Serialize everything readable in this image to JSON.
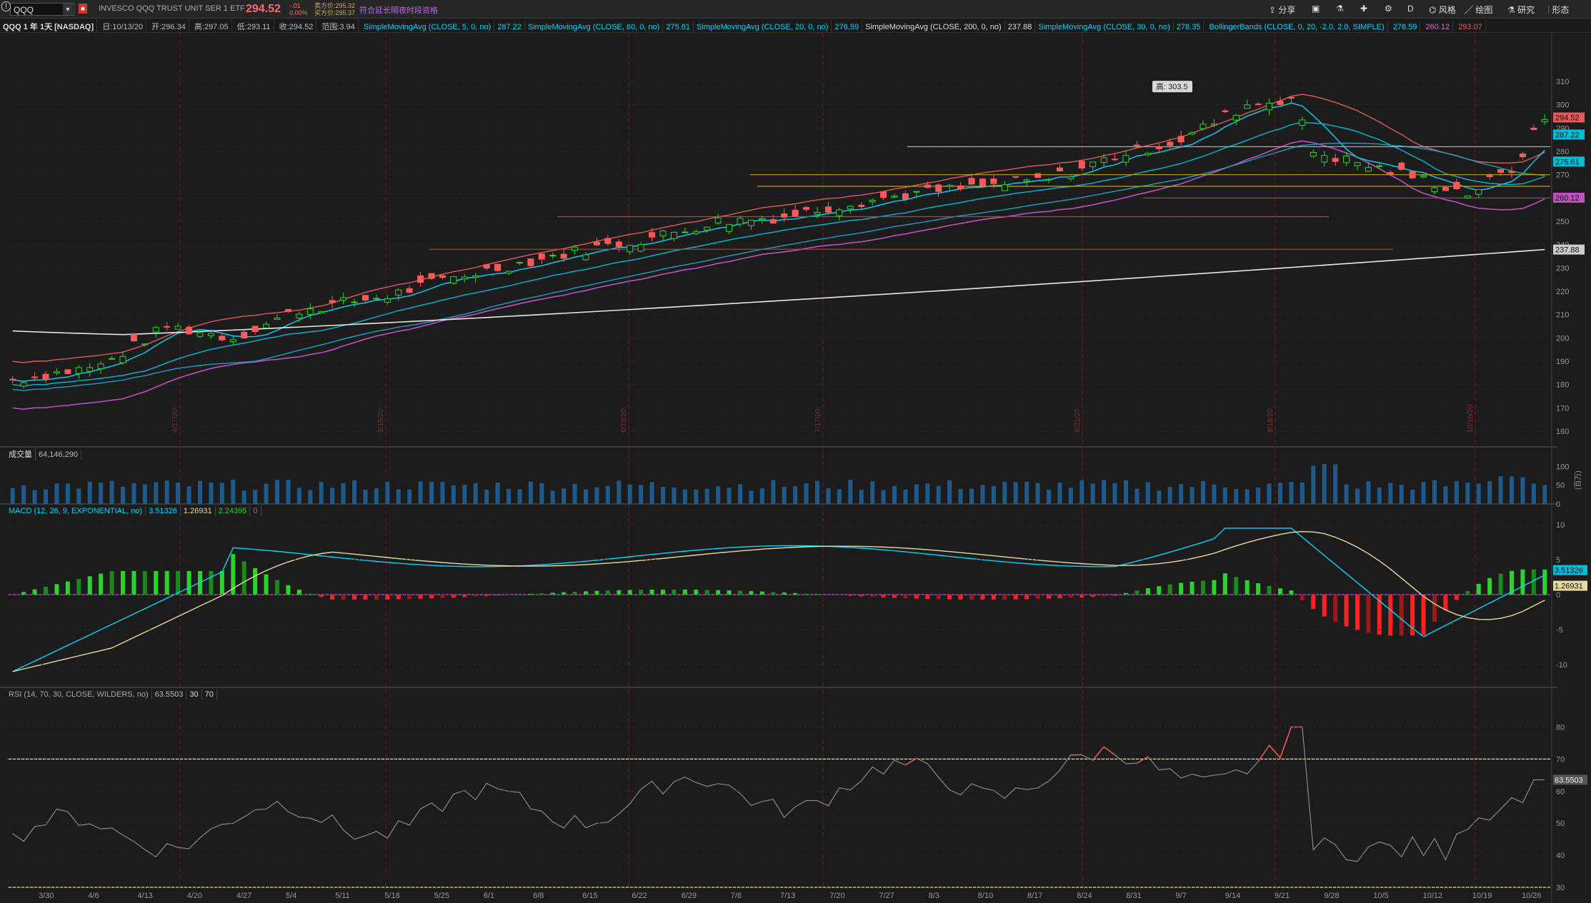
{
  "toolbar": {
    "symbol": "QQQ",
    "description": "INVESCO QQQ TRUST UNIT SER 1 ETF",
    "last": "294.52",
    "change": "-.01",
    "change_pct": "0.00%",
    "bid": "卖方价:295.32",
    "ask": "买方价:295.37",
    "extended": "符合延长隔夜时段资格",
    "share": "分享",
    "interval": "D",
    "style": "风格",
    "drawings": "绘图",
    "studies": "研究",
    "patterns": "形态"
  },
  "studybar": {
    "title": "QQQ 1 年 1天 [NASDAQ]",
    "date": "日:10/13/20",
    "open": "开:296.34",
    "high": "高:297.05",
    "low": "低:293.11",
    "close": "收:294.52",
    "range": "范围:3.94",
    "studies": [
      {
        "label": "SimpleMovingAvg (CLOSE, 5, 0, no)",
        "value": "287.22",
        "color": "#00d6ff"
      },
      {
        "label": "SimpleMovingAvg (CLOSE, 60, 0, no)",
        "value": "275.61",
        "color": "#00d6ff"
      },
      {
        "label": "SimpleMovingAvg (CLOSE, 20, 0, no)",
        "value": "276.59",
        "color": "#00d6ff"
      },
      {
        "label": "SimpleMovingAvg (CLOSE, 200, 0, no)",
        "value": "237.88",
        "color": "#dddddd"
      },
      {
        "label": "SimpleMovingAvg (CLOSE, 30, 0, no)",
        "value": "278.35",
        "color": "#00d6ff"
      }
    ],
    "bollinger": {
      "label": "BollingerBands (CLOSE, 0, 20, -2.0, 2.0, SIMPLE)",
      "mid": "276.59",
      "low": "260.12",
      "high": "293.07"
    }
  },
  "price_pane": {
    "high_label": "高: 303.5",
    "y_ticks": [
      "310",
      "300",
      "290",
      "280",
      "270",
      "260",
      "250",
      "240",
      "230",
      "220",
      "210",
      "200",
      "190",
      "180",
      "170",
      "160"
    ],
    "v_markers": [
      "4/17/20",
      "5/15/20",
      "6/19/20",
      "7/17/20",
      "8/21/20",
      "9/18/20",
      "10/16/20"
    ],
    "tags": [
      {
        "text": "294.52",
        "color": "#e45a5a",
        "v": 294.52
      },
      {
        "text": "287.22",
        "color": "#00bcd4",
        "v": 287.22
      },
      {
        "text": "275.61",
        "color": "#00bcd4",
        "v": 275.61
      },
      {
        "text": "260.12",
        "color": "#c050c0",
        "v": 260.12
      },
      {
        "text": "237.88",
        "color": "#cccccc",
        "v": 237.88
      }
    ]
  },
  "volume_pane": {
    "label": "成交量",
    "value": "64,146,290",
    "y_ticks": [
      "100",
      "50",
      "0"
    ],
    "unit": "(百万)"
  },
  "macd_pane": {
    "label": "MACD (12, 26, 9, EXPONENTIAL, no)",
    "value": "3.51326",
    "avg": "1.26931",
    "diff": "2.24395",
    "zero": "0",
    "y_ticks": [
      "10",
      "5",
      "0",
      "-5",
      "-10"
    ],
    "tags": [
      {
        "text": "3.51326",
        "color": "#00bcd4",
        "v": 3.51
      },
      {
        "text": "1.26931",
        "color": "#e8d9a0",
        "v": 1.27
      }
    ]
  },
  "rsi_pane": {
    "label": "RSI (14, 70, 30, CLOSE, WILDERS, no)",
    "value": "63.5503",
    "os": "30",
    "ob": "70",
    "y_ticks": [
      "80",
      "70",
      "60",
      "50",
      "40",
      "30"
    ],
    "tag": "63.5503"
  },
  "x_axis": {
    "labels": [
      "3/30",
      "4/6",
      "4/13",
      "4/20",
      "4/27",
      "5/4",
      "5/11",
      "5/18",
      "5/25",
      "6/1",
      "6/8",
      "6/15",
      "6/22",
      "6/29",
      "7/6",
      "7/13",
      "7/20",
      "7/27",
      "8/3",
      "8/10",
      "8/17",
      "8/24",
      "8/31",
      "9/7",
      "9/14",
      "9/21",
      "9/28",
      "10/5",
      "10/12",
      "10/19",
      "10/26"
    ]
  }
}
